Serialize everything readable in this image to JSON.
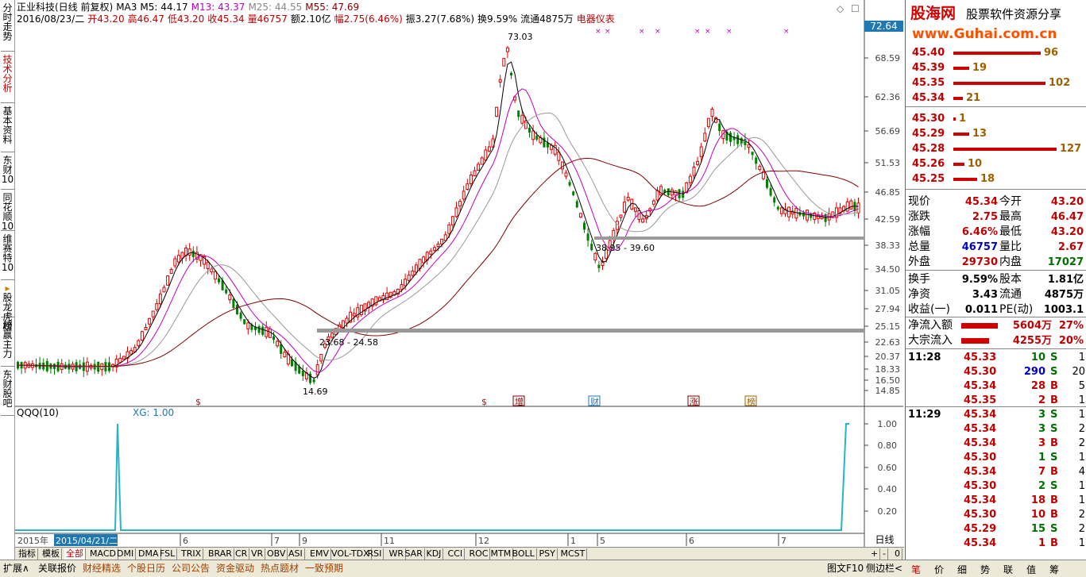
{
  "left_tabs": [
    {
      "label": "分时走势"
    },
    {
      "label": "技术分析",
      "active": true
    },
    {
      "label": "基本资料"
    },
    {
      "label": "东财10"
    },
    {
      "label": "同花顺10"
    },
    {
      "label": "维赛特10"
    },
    {
      "label": "股龙虎榜",
      "arrow": true
    },
    {
      "label": "超赢主力"
    },
    {
      "label": "东财股吧"
    }
  ],
  "header": {
    "stock_name": "正业科技(日线 前复权)",
    "ma_label": "MA3",
    "ma5": "M5: 44.17",
    "ma13": "M13: 43.37",
    "ma25": "M25: 44.55",
    "ma55": "M55: 47.69",
    "date": "2016/08/23/二",
    "open": "开43.20",
    "high": "高46.47",
    "low": "低43.20",
    "close": "收45.34",
    "volume": "量46757",
    "amount": "额2.10亿",
    "change": "幅2.75(6.46%)",
    "amplitude": "振3.27(7.68%)",
    "turnover": "换9.59%",
    "float": "流通4875万",
    "sector": "电器仪表",
    "price_box": "72.64"
  },
  "price_axis": [
    "68.59",
    "62.36",
    "56.69",
    "51.53",
    "46.85",
    "42.59",
    "38.33",
    "34.50",
    "31.05",
    "27.94",
    "25.15",
    "22.63",
    "20.37",
    "18.33",
    "16.50",
    "14.85"
  ],
  "annotations": {
    "high": "73.03",
    "low": "14.69",
    "range1": "38.95 - 39.60",
    "range2": "23.68 - 24.58"
  },
  "event_markers": [
    "$",
    "$",
    "增",
    "财",
    "涨",
    "榜"
  ],
  "indicator": {
    "name": "QQQ(10)",
    "xg": "XG: 1.00",
    "axis": [
      "1.00",
      "0.80",
      "0.60",
      "0.40",
      "0.20"
    ]
  },
  "time_axis": {
    "year": "2015年",
    "cursor": "2015/04/21/二",
    "months": [
      "6",
      "7",
      "9",
      "11",
      "12",
      "1",
      "5",
      "6",
      "7",
      "8"
    ]
  },
  "period": "日线",
  "indicator_tabs": [
    "指标",
    "模板",
    "全部",
    "MACD",
    "DMI",
    "DMA",
    "FSL",
    "TRIX",
    "BRAR",
    "CR",
    "VR",
    "OBV",
    "ASI",
    "EMV",
    "VOL-TDX",
    "RSI",
    "WR",
    "SAR",
    "KDJ",
    "CCI",
    "ROC",
    "MTM",
    "BOLL",
    "PSY",
    "MCST"
  ],
  "nav_controls": [
    "+",
    "-",
    "0"
  ],
  "bottom_bar": [
    "扩展∧",
    "关联报价",
    "财经精选",
    "个股日历",
    "公司公告",
    "资金驱动",
    "热点题材",
    "一致预期"
  ],
  "bottom_right": [
    "图文F10",
    "侧边栏<"
  ],
  "right_tabs": [
    "笔",
    "价",
    "细",
    "势",
    "联",
    "值",
    "筹"
  ],
  "logo": {
    "text": "股海网",
    "slogan": "股票软件资源分享",
    "url": "www.Guhai.com.cn"
  },
  "order_book": [
    {
      "price": "45.40",
      "vol": "96"
    },
    {
      "price": "45.39",
      "vol": "19"
    },
    {
      "price": "45.35",
      "vol": "102"
    },
    {
      "price": "45.34",
      "vol": "21"
    },
    {
      "price": "45.30",
      "vol": "1"
    },
    {
      "price": "45.29",
      "vol": "13"
    },
    {
      "price": "45.28",
      "vol": "127"
    },
    {
      "price": "45.26",
      "vol": "10"
    },
    {
      "price": "45.25",
      "vol": "18"
    }
  ],
  "quote": [
    {
      "l1": "现价",
      "v1": "45.34",
      "l2": "今开",
      "v2": "43.20"
    },
    {
      "l1": "涨跌",
      "v1": "2.75",
      "l2": "最高",
      "v2": "46.47"
    },
    {
      "l1": "涨幅",
      "v1": "6.46%",
      "l2": "最低",
      "v2": "43.20"
    },
    {
      "l1": "总量",
      "v1": "46757",
      "l2": "量比",
      "v2": "2.67"
    },
    {
      "l1": "外盘",
      "v1": "29730",
      "l2": "内盘",
      "v2": "17027"
    },
    {
      "l1": "换手",
      "v1": "9.59%",
      "l2": "股本",
      "v2": "1.81亿"
    },
    {
      "l1": "净资",
      "v1": "3.43",
      "l2": "流通",
      "v2": "4875万"
    },
    {
      "l1": "收益(一)",
      "v1": "0.011",
      "l2": "PE(动)",
      "v2": "1003.1"
    }
  ],
  "flows": [
    {
      "label": "净流入额",
      "value": "5604万",
      "pct": "27%"
    },
    {
      "label": "大宗流入",
      "value": "4255万",
      "pct": "20%"
    }
  ],
  "ticks_1128": {
    "time": "11:28",
    "rows": [
      {
        "price": "45.33",
        "vol": "10",
        "side": "S",
        "n": "1"
      },
      {
        "price": "45.30",
        "vol": "290",
        "side": "S",
        "n": "20"
      },
      {
        "price": "45.34",
        "vol": "28",
        "side": "B",
        "n": "5"
      },
      {
        "price": "45.35",
        "vol": "2",
        "side": "B",
        "n": "1"
      }
    ]
  },
  "ticks_1129": {
    "time": "11:29",
    "rows": [
      {
        "price": "45.34",
        "vol": "3",
        "side": "S",
        "n": "1"
      },
      {
        "price": "45.34",
        "vol": "3",
        "side": "S",
        "n": "2"
      },
      {
        "price": "45.34",
        "vol": "3",
        "side": "B",
        "n": "2"
      },
      {
        "price": "45.30",
        "vol": "1",
        "side": "S",
        "n": "1"
      },
      {
        "price": "45.34",
        "vol": "7",
        "side": "B",
        "n": "4"
      },
      {
        "price": "45.30",
        "vol": "2",
        "side": "S",
        "n": "1"
      },
      {
        "price": "45.34",
        "vol": "18",
        "side": "B",
        "n": "1"
      },
      {
        "price": "45.30",
        "vol": "10",
        "side": "B",
        "n": "2"
      },
      {
        "price": "45.29",
        "vol": "15",
        "side": "S",
        "n": "2"
      },
      {
        "price": "45.34",
        "vol": "1",
        "side": "B",
        "n": "1"
      }
    ]
  }
}
